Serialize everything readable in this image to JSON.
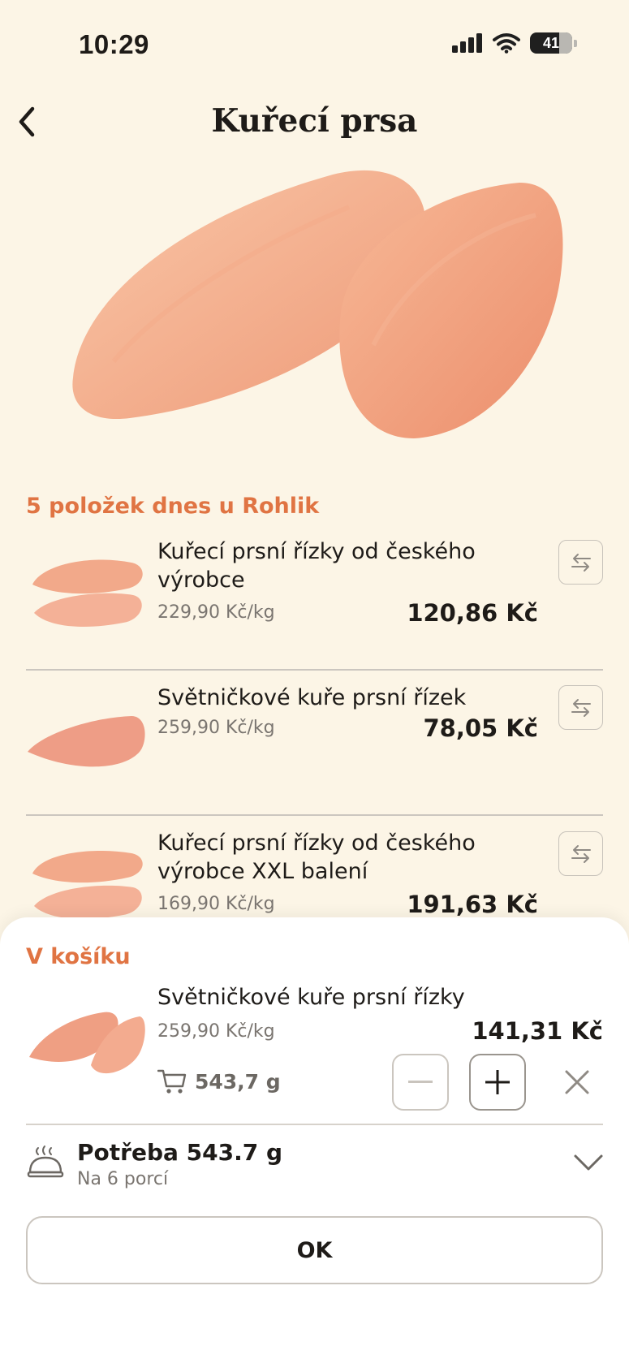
{
  "status_bar": {
    "time": "10:29",
    "battery": "41"
  },
  "header": {
    "title": "Kuřecí prsa"
  },
  "offers": {
    "heading": "5 položek dnes u Rohlik",
    "items": [
      {
        "name": "Kuřecí prsní řízky od českého výrobce",
        "unit_price": "229,90 Kč/kg",
        "price": "120,86 Kč"
      },
      {
        "name": "Světničkové kuře prsní řízek",
        "unit_price": "259,90 Kč/kg",
        "price": "78,05 Kč"
      },
      {
        "name": "Kuřecí prsní řízky od českého výrobce XXL balení",
        "unit_price": "169,90 Kč/kg",
        "price": "191,63 Kč"
      }
    ]
  },
  "cart": {
    "heading": "V košíku",
    "item": {
      "name": "Světničkové kuře prsní řízky",
      "unit_price": "259,90 Kč/kg",
      "price": "141,31 Kč",
      "weight": "543,7 g"
    }
  },
  "need": {
    "title": "Potřeba 543.7 g",
    "subtitle": "Na 6 porcí"
  },
  "ok_label": "OK",
  "colors": {
    "accent": "#e07443",
    "background": "#fcf5e6"
  },
  "icons": [
    "back-chevron-icon",
    "swap-icon",
    "cart-icon",
    "minus-icon",
    "plus-icon",
    "close-icon",
    "serving-dish-icon",
    "chevron-down-icon"
  ]
}
